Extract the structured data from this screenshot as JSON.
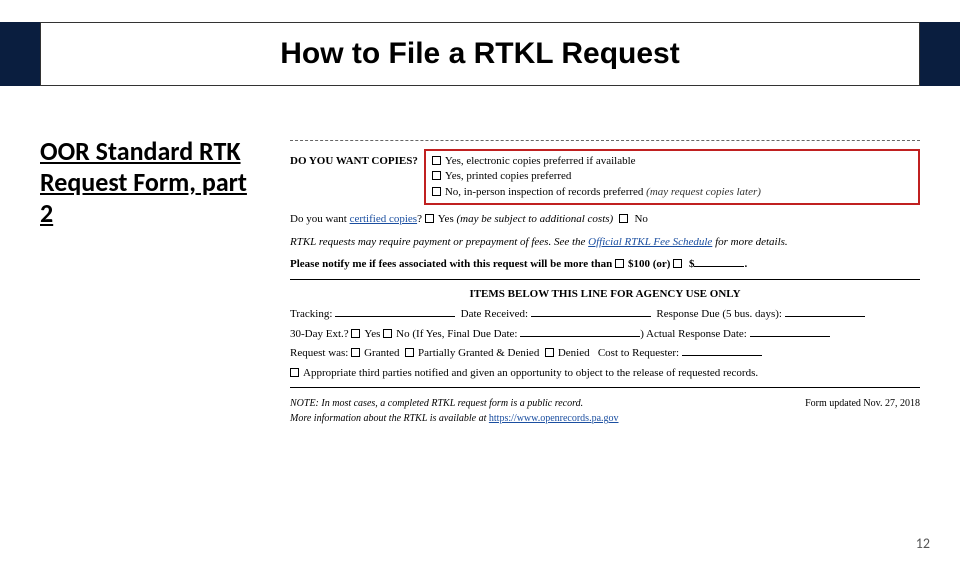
{
  "title": "How to File a RTKL Request",
  "subtitle": "OOR Standard RTK Request Form, part 2",
  "form": {
    "copies_label": "DO YOU WANT COPIES?",
    "opt1": "Yes, electronic copies preferred if available",
    "opt2": "Yes, printed copies preferred",
    "opt3_a": "No, in-person inspection of records preferred ",
    "opt3_b": "(may request copies later)",
    "certified_a": "Do you want ",
    "certified_link": "certified copies",
    "certified_b": "? ",
    "certified_yes": "Yes ",
    "certified_yes_paren": "(may be subject to additional costs)",
    "certified_no": " No",
    "fees_a": "RTKL requests may require payment or prepayment of fees. See the ",
    "fees_link": "Official RTKL Fee Schedule",
    "fees_b": " for more details.",
    "notify_a": "Please notify me if fees associated with this request will be more than",
    "notify_100": "$100 ",
    "notify_or": "(or)",
    "notify_blank_prefix": " $",
    "section_header": "ITEMS BELOW THIS LINE FOR AGENCY USE ONLY",
    "tracking": "Tracking:",
    "date_received": "Date Received:",
    "response_due": "Response Due (5 bus. days):",
    "ext": "30-Day Ext.?",
    "ext_yes": "Yes",
    "ext_no": "No (If Yes, Final Due Date:",
    "actual": ") Actual Response Date:",
    "request_was": "Request was:",
    "granted": "Granted",
    "partial": "Partially Granted & Denied",
    "denied": "Denied",
    "cost": "Cost to Requester:",
    "third_party": "Appropriate third parties notified and given an opportunity to object to the release of requested records.",
    "note1": "NOTE: In most cases, a completed RTKL request form is a public record.",
    "note2a": "More information about the RTKL is available at ",
    "note2b": "https://www.openrecords.pa.gov",
    "form_date": "Form updated Nov. 27, 2018"
  },
  "page_number": "12"
}
